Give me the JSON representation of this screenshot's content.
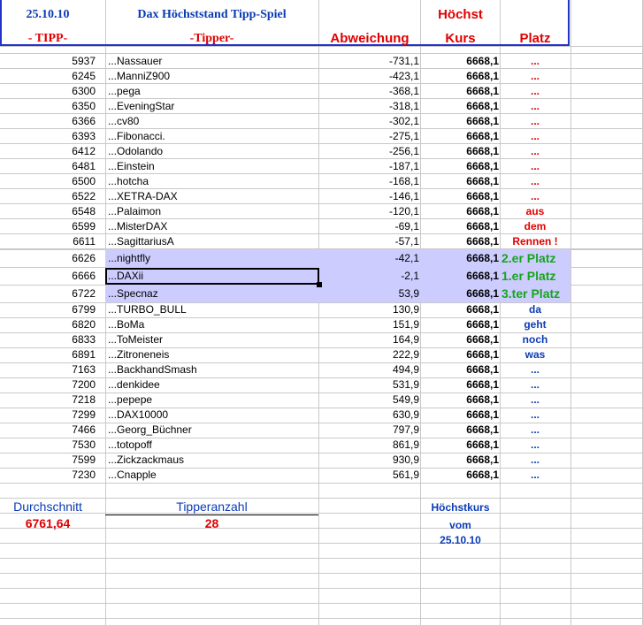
{
  "header": {
    "date": "25.10.10",
    "title": "Dax Höchststand Tipp-Spiel",
    "col_tipp": "- TIPP-",
    "col_tipper": "-Tipper-",
    "col_abweichung": "Abweichung",
    "col_hoechst": "Höchst",
    "col_kurs": "Kurs",
    "col_platz": "Platz"
  },
  "rows": [
    {
      "tipp": "5937",
      "name": "...Nassauer",
      "abw": "-731,1",
      "kurs": "6668,1",
      "platz": "...",
      "platz_style": "red"
    },
    {
      "tipp": "6245",
      "name": "...ManniZ900",
      "abw": "-423,1",
      "kurs": "6668,1",
      "platz": "...",
      "platz_style": "red"
    },
    {
      "tipp": "6300",
      "name": "...pega",
      "abw": "-368,1",
      "kurs": "6668,1",
      "platz": "...",
      "platz_style": "red"
    },
    {
      "tipp": "6350",
      "name": "...EveningStar",
      "abw": "-318,1",
      "kurs": "6668,1",
      "platz": "...",
      "platz_style": "red"
    },
    {
      "tipp": "6366",
      "name": "...cv80",
      "abw": "-302,1",
      "kurs": "6668,1",
      "platz": "...",
      "platz_style": "red"
    },
    {
      "tipp": "6393",
      "name": "...Fibonacci.",
      "abw": "-275,1",
      "kurs": "6668,1",
      "platz": "...",
      "platz_style": "red"
    },
    {
      "tipp": "6412",
      "name": "...Odolando",
      "abw": "-256,1",
      "kurs": "6668,1",
      "platz": "...",
      "platz_style": "red"
    },
    {
      "tipp": "6481",
      "name": "...Einstein",
      "abw": "-187,1",
      "kurs": "6668,1",
      "platz": "...",
      "platz_style": "red"
    },
    {
      "tipp": "6500",
      "name": "...hotcha",
      "abw": "-168,1",
      "kurs": "6668,1",
      "platz": "...",
      "platz_style": "red"
    },
    {
      "tipp": "6522",
      "name": "...XETRA-DAX",
      "abw": "-146,1",
      "kurs": "6668,1",
      "platz": "...",
      "platz_style": "red"
    },
    {
      "tipp": "6548",
      "name": "...Palaimon",
      "abw": "-120,1",
      "kurs": "6668,1",
      "platz": "aus",
      "platz_style": "red"
    },
    {
      "tipp": "6599",
      "name": "...MisterDAX",
      "abw": "-69,1",
      "kurs": "6668,1",
      "platz": "dem",
      "platz_style": "red"
    },
    {
      "tipp": "6611",
      "name": "...SagittariusA",
      "abw": "-57,1",
      "kurs": "6668,1",
      "platz": "Rennen !",
      "platz_style": "red"
    },
    {
      "tipp": "6626",
      "name": "...nightfly",
      "abw": "-42,1",
      "kurs": "6668,1",
      "platz": "2.er Platz",
      "platz_style": "green"
    },
    {
      "tipp": "6666",
      "name": "...DAXii",
      "abw": "-2,1",
      "kurs": "6668,1",
      "platz": "1.er Platz",
      "platz_style": "green"
    },
    {
      "tipp": "6722",
      "name": "...Specnaz",
      "abw": "53,9",
      "kurs": "6668,1",
      "platz": "3.ter Platz",
      "platz_style": "green"
    },
    {
      "tipp": "6799",
      "name": "...TURBO_BULL",
      "abw": "130,9",
      "kurs": "6668,1",
      "platz": "da",
      "platz_style": "blue"
    },
    {
      "tipp": "6820",
      "name": "...BoMa",
      "abw": "151,9",
      "kurs": "6668,1",
      "platz": "geht",
      "platz_style": "blue"
    },
    {
      "tipp": "6833",
      "name": "...ToMeister",
      "abw": "164,9",
      "kurs": "6668,1",
      "platz": "noch",
      "platz_style": "blue"
    },
    {
      "tipp": "6891",
      "name": "...Zitroneneis",
      "abw": "222,9",
      "kurs": "6668,1",
      "platz": "was",
      "platz_style": "blue"
    },
    {
      "tipp": "7163",
      "name": "...BackhandSmash",
      "abw": "494,9",
      "kurs": "6668,1",
      "platz": "...",
      "platz_style": "blue"
    },
    {
      "tipp": "7200",
      "name": "...denkidee",
      "abw": "531,9",
      "kurs": "6668,1",
      "platz": "...",
      "platz_style": "blue"
    },
    {
      "tipp": "7218",
      "name": "...pepepe",
      "abw": "549,9",
      "kurs": "6668,1",
      "platz": "...",
      "platz_style": "blue"
    },
    {
      "tipp": "7299",
      "name": "...DAX10000",
      "abw": "630,9",
      "kurs": "6668,1",
      "platz": "...",
      "platz_style": "blue"
    },
    {
      "tipp": "7466",
      "name": "...Georg_Büchner",
      "abw": "797,9",
      "kurs": "6668,1",
      "platz": "...",
      "platz_style": "blue"
    },
    {
      "tipp": "7530",
      "name": "...totopoff",
      "abw": "861,9",
      "kurs": "6668,1",
      "platz": "...",
      "platz_style": "blue"
    },
    {
      "tipp": "7599",
      "name": "...Zickzackmaus",
      "abw": "930,9",
      "kurs": "6668,1",
      "platz": "...",
      "platz_style": "blue"
    },
    {
      "tipp": "7230",
      "name": "...Cnapple",
      "abw": "561,9",
      "kurs": "6668,1",
      "platz": "...",
      "platz_style": "blue"
    }
  ],
  "footer": {
    "durchschnitt_label": "Durchschnitt",
    "durchschnitt_value": "6761,64",
    "tipperanzahl_label": "Tipperanzahl",
    "tipperanzahl_value": "28",
    "hoechstkurs_label": "Höchstkurs",
    "vom_label": "vom",
    "hoechstkurs_date": "25.10.10"
  },
  "colors": {
    "header_border": "#2233cc",
    "highlight": "#ccccff",
    "red": "#e00000",
    "blue": "#0b3bb5",
    "green": "#17a51a"
  }
}
